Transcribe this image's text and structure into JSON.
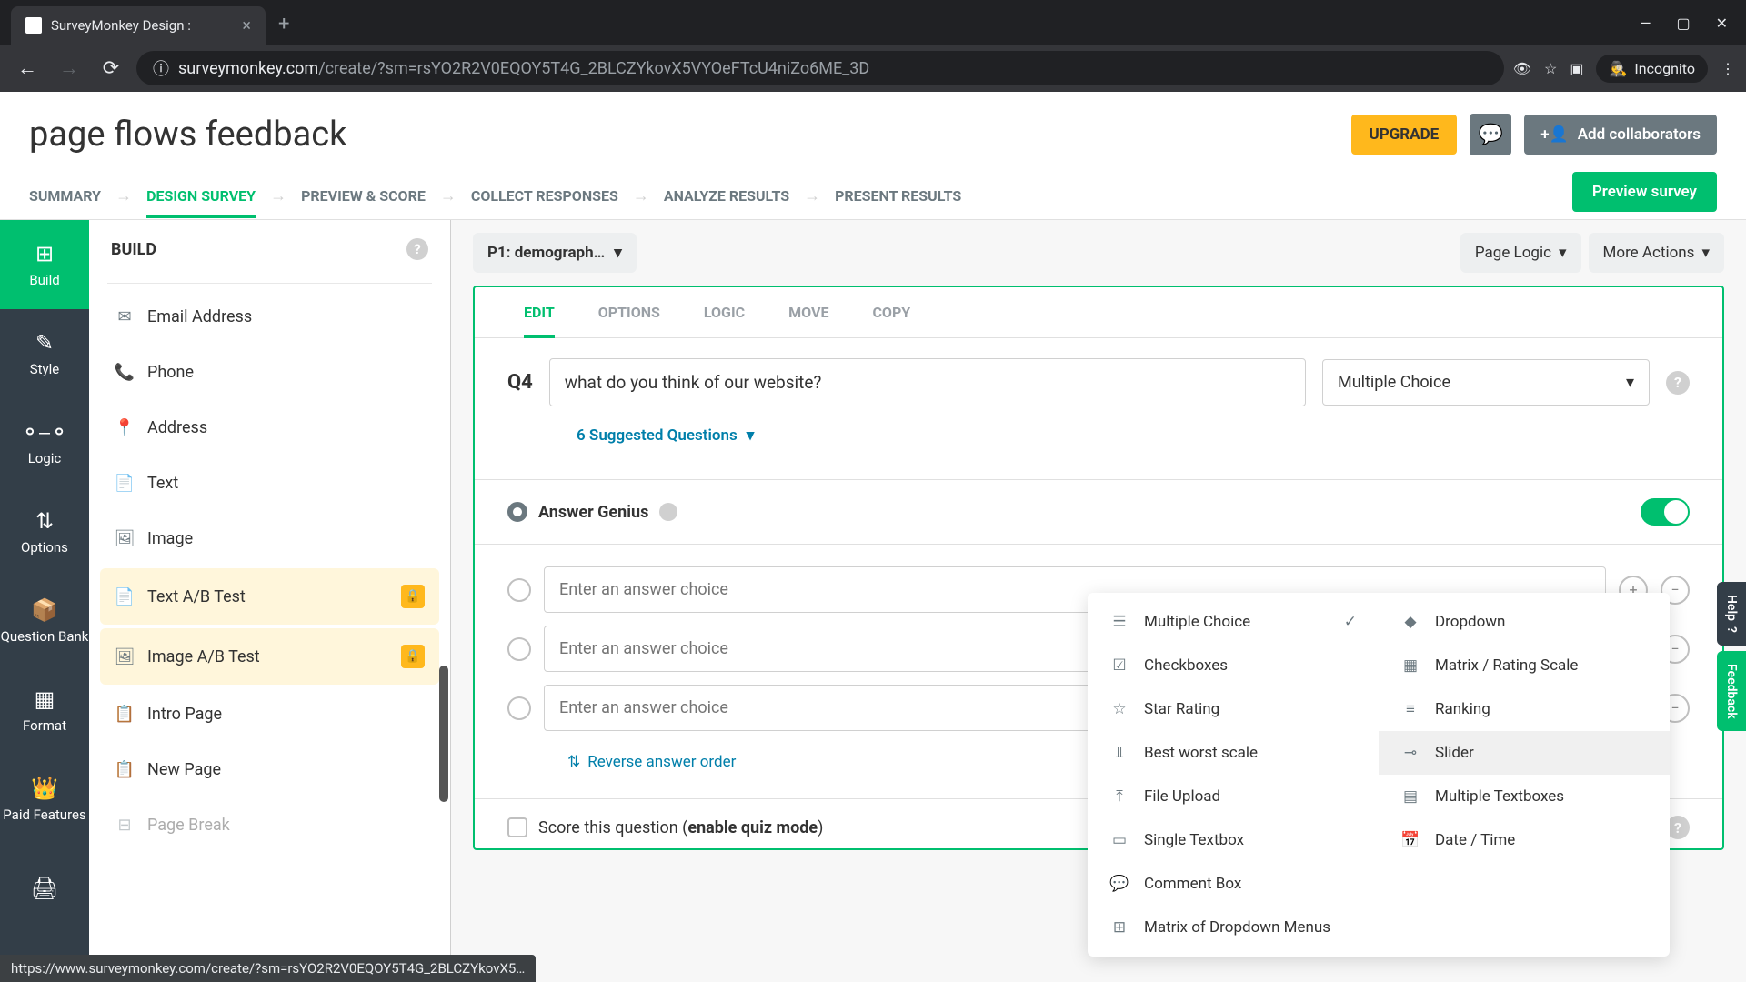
{
  "browser": {
    "tab_title": "SurveyMonkey Design :",
    "url_domain": "surveymonkey.com",
    "url_path": "/create/?sm=rsYO2R2V0EQOY5T4G_2BLCZYkovX5VYOeFTcU4niZo6ME_3D",
    "incognito": "Incognito"
  },
  "header": {
    "title": "page flows feedback",
    "upgrade": "UPGRADE",
    "collaborators": "Add collaborators"
  },
  "nav": {
    "summary": "SUMMARY",
    "design": "DESIGN SURVEY",
    "preview": "PREVIEW & SCORE",
    "collect": "COLLECT RESPONSES",
    "analyze": "ANALYZE RESULTS",
    "present": "PRESENT RESULTS",
    "preview_btn": "Preview survey"
  },
  "rail": {
    "build": "Build",
    "style": "Style",
    "logic": "Logic",
    "options": "Options",
    "qbank": "Question Bank",
    "format": "Format",
    "paid": "Paid Features"
  },
  "build": {
    "title": "BUILD",
    "items": {
      "email": "Email Address",
      "phone": "Phone",
      "address": "Address",
      "text": "Text",
      "image": "Image",
      "textab": "Text A/B Test",
      "imageab": "Image A/B Test",
      "intro": "Intro Page",
      "newpage": "New Page",
      "pagebreak": "Page Break"
    }
  },
  "canvas": {
    "page_selector": "P1: demograph…",
    "page_logic": "Page Logic",
    "more_actions": "More Actions"
  },
  "question": {
    "tabs": {
      "edit": "EDIT",
      "options": "OPTIONS",
      "logic": "LOGIC",
      "move": "MOVE",
      "copy": "COPY"
    },
    "num": "Q4",
    "text": "what do you think of our website?",
    "type": "Multiple Choice",
    "suggested": "6 Suggested Questions",
    "answer_genius": "Answer Genius",
    "placeholder": "Enter an answer choice",
    "reverse": "Reverse answer order",
    "score_prefix": "Score this question (",
    "score_link": "enable quiz mode",
    "score_suffix": ")"
  },
  "qtypes": {
    "multiple_choice": "Multiple Choice",
    "dropdown": "Dropdown",
    "checkboxes": "Checkboxes",
    "matrix": "Matrix / Rating Scale",
    "star": "Star Rating",
    "ranking": "Ranking",
    "bestworst": "Best worst scale",
    "slider": "Slider",
    "fileupload": "File Upload",
    "multitext": "Multiple Textboxes",
    "singletext": "Single Textbox",
    "datetime": "Date / Time",
    "comment": "Comment Box",
    "matrixdd": "Matrix of Dropdown Menus"
  },
  "side": {
    "help": "Help",
    "feedback": "Feedback"
  },
  "status_bar": "https://www.surveymonkey.com/create/?sm=rsYO2R2V0EQOY5T4G_2BLCZYkovX5…"
}
